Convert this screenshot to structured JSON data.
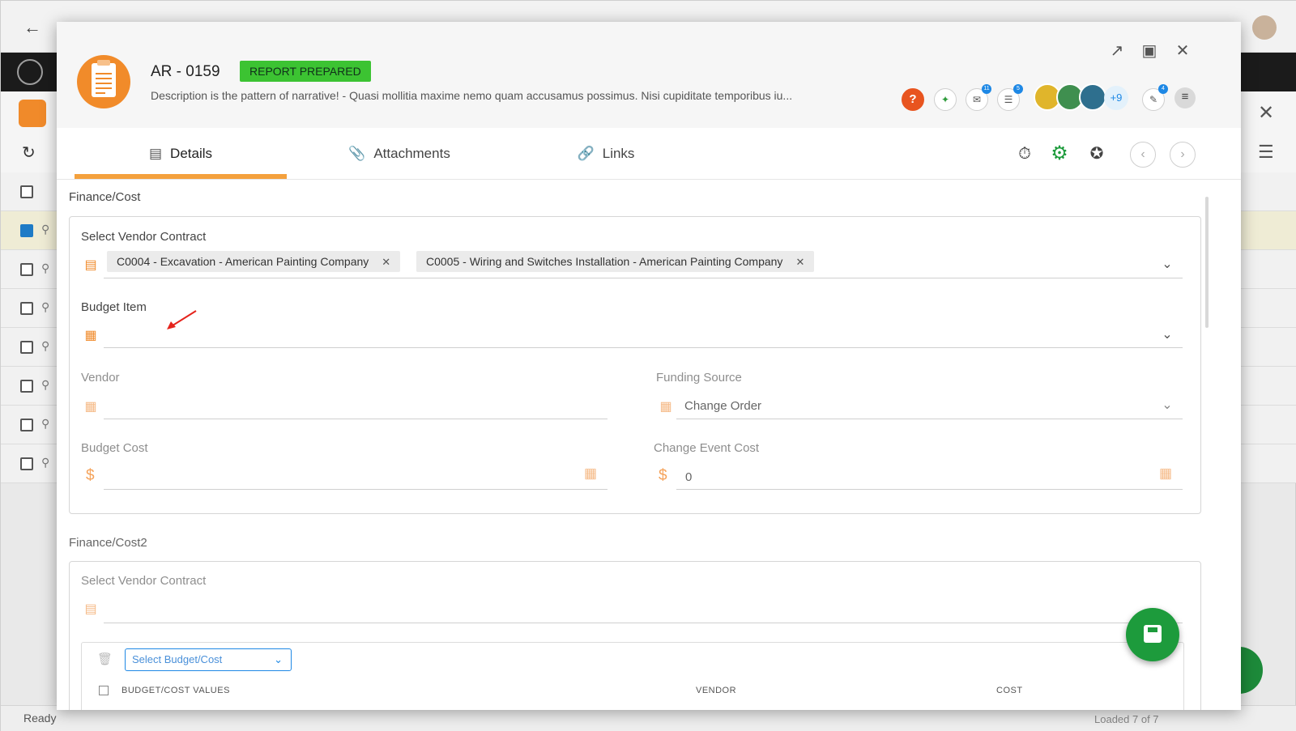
{
  "background": {
    "status": "Ready",
    "loaded": "Loaded 7 of 7",
    "row_count": 7
  },
  "record": {
    "id": "AR - 0159",
    "status": "REPORT PREPARED",
    "description": "Description is the pattern of narrative!  - Quasi mollitia maxime nemo quam accusamus possimus. Nisi cupiditate temporibus iu...",
    "icon": "accident-report-icon"
  },
  "header_badges": {
    "notifications": "11",
    "tasks": "5",
    "comments": "4",
    "more_users": "+9"
  },
  "tabs": [
    {
      "label": "Details",
      "icon": "details-icon"
    },
    {
      "label": "Attachments",
      "icon": "paperclip-icon"
    },
    {
      "label": "Links",
      "icon": "link-icon"
    }
  ],
  "section1": {
    "title": "Finance/Cost",
    "vendor_contract_label": "Select Vendor Contract",
    "chips": [
      "C0004 - Excavation - American Painting Company",
      "C0005 - Wiring and Switches Installation - American Painting Company"
    ],
    "budget_item_label": "Budget Item",
    "vendor_label": "Vendor",
    "funding_source_label": "Funding Source",
    "funding_source_value": "Change Order",
    "budget_cost_label": "Budget Cost",
    "change_event_cost_label": "Change Event Cost",
    "change_event_cost_value": "0",
    "currency": "$"
  },
  "section2": {
    "title": "Finance/Cost2",
    "vendor_contract_label": "Select Vendor Contract",
    "select_budget": "Select Budget/Cost",
    "columns": [
      "BUDGET/COST VALUES",
      "VENDOR",
      "COST"
    ]
  },
  "colors": {
    "accent": "#f4a13d",
    "status_green": "#3cc332",
    "save_green": "#1d9b3c"
  }
}
